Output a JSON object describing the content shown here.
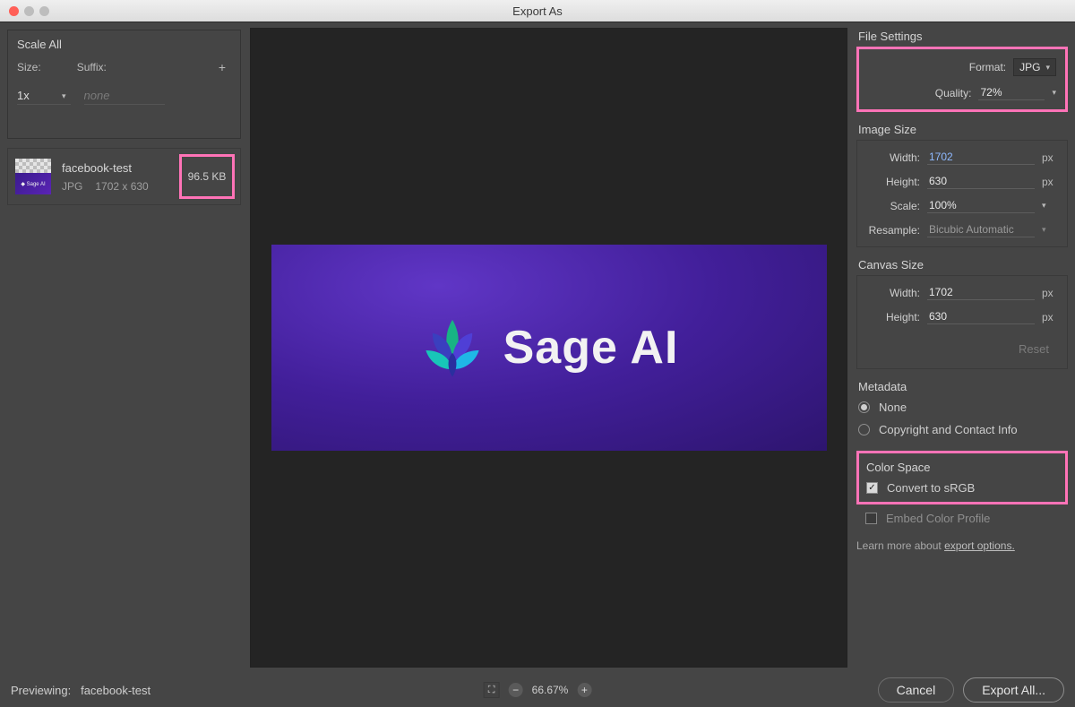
{
  "window": {
    "title": "Export As"
  },
  "scale_all": {
    "title": "Scale All",
    "size_label": "Size:",
    "suffix_label": "Suffix:",
    "size_value": "1x",
    "suffix_placeholder": "none"
  },
  "asset": {
    "name": "facebook-test",
    "format": "JPG",
    "dimensions": "1702 x 630",
    "filesize": "96.5 KB"
  },
  "preview": {
    "brand_text": "Sage AI"
  },
  "file_settings": {
    "title": "File Settings",
    "format_label": "Format:",
    "format_value": "JPG",
    "quality_label": "Quality:",
    "quality_value": "72%"
  },
  "image_size": {
    "title": "Image Size",
    "width_label": "Width:",
    "width_value": "1702",
    "height_label": "Height:",
    "height_value": "630",
    "scale_label": "Scale:",
    "scale_value": "100%",
    "resample_label": "Resample:",
    "resample_value": "Bicubic Automatic",
    "unit": "px"
  },
  "canvas_size": {
    "title": "Canvas Size",
    "width_label": "Width:",
    "width_value": "1702",
    "height_label": "Height:",
    "height_value": "630",
    "unit": "px",
    "reset": "Reset"
  },
  "metadata": {
    "title": "Metadata",
    "none": "None",
    "copyright": "Copyright and Contact Info"
  },
  "color_space": {
    "title": "Color Space",
    "convert": "Convert to sRGB",
    "embed": "Embed Color Profile"
  },
  "learn": {
    "prefix": "Learn more about ",
    "link": "export options."
  },
  "footer": {
    "previewing_label": "Previewing:",
    "previewing_name": "facebook-test",
    "zoom": "66.67%",
    "cancel": "Cancel",
    "export": "Export All..."
  }
}
